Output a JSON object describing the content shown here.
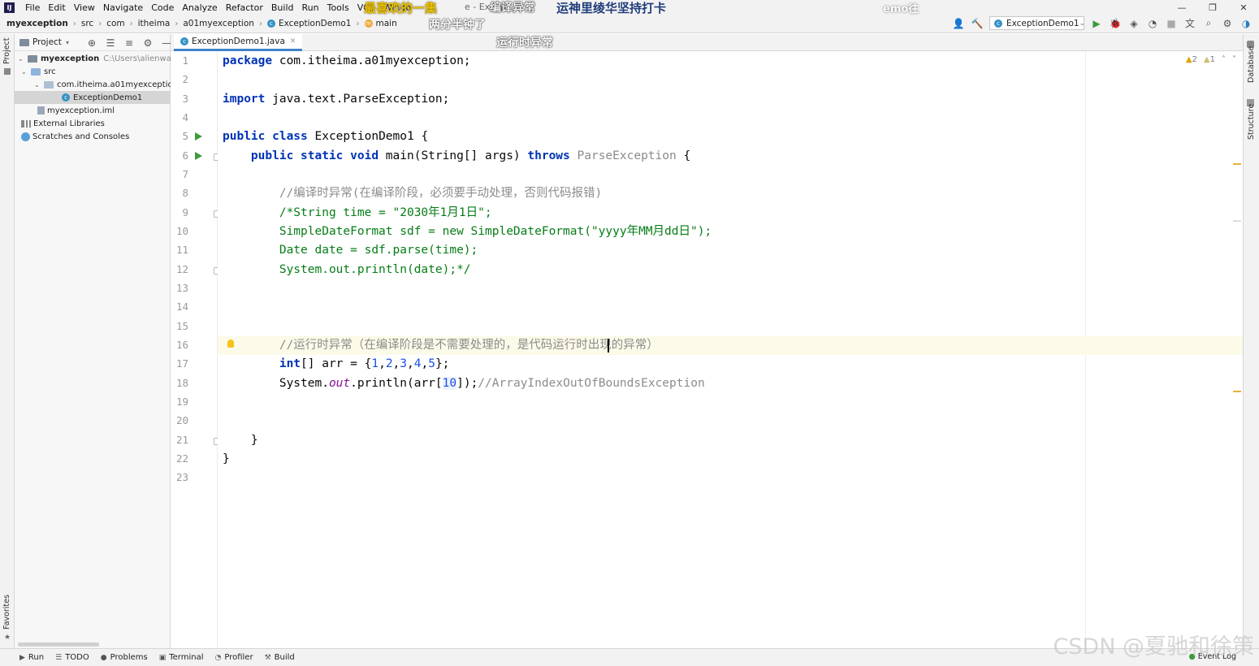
{
  "menubar": {
    "items": [
      "File",
      "Edit",
      "View",
      "Navigate",
      "Code",
      "Analyze",
      "Refactor",
      "Build",
      "Run",
      "Tools",
      "VCS",
      "Windo"
    ],
    "title": "e - Except"
  },
  "overlays": {
    "top1": "最喜欢的一集",
    "top2": "编译异常",
    "top3": "运神里绫华坚持打卡",
    "top4": "emo往",
    "mid1": "两分半钟了",
    "mid2": "运行时异常"
  },
  "breadcrumb": {
    "project": "myexception",
    "parts": [
      "src",
      "com",
      "itheima",
      "a01myexception"
    ],
    "class": "ExceptionDemo1",
    "method": "main"
  },
  "toolbar": {
    "run_config": "ExceptionDemo1"
  },
  "project_panel": {
    "header": "Project",
    "root": "myexception",
    "root_path": "C:\\Users\\alienware\\Id",
    "src": "src",
    "package": "com.itheima.a01myexception",
    "class_file": "ExceptionDemo1",
    "iml": "myexception.iml",
    "ext_libs": "External Libraries",
    "scratches": "Scratches and Consoles"
  },
  "left_strip": {
    "project_tab": "Project",
    "favorites_tab": "Favorites"
  },
  "right_strip": {
    "database_tab": "Database",
    "structure_tab": "Structure"
  },
  "editor": {
    "tab_name": "ExceptionDemo1.java",
    "warnings": "2",
    "weak_warnings": "1",
    "line_numbers": [
      "1",
      "2",
      "3",
      "4",
      "5",
      "6",
      "7",
      "8",
      "9",
      "10",
      "11",
      "12",
      "13",
      "14",
      "15",
      "16",
      "17",
      "18",
      "19",
      "20",
      "21",
      "22",
      "23"
    ],
    "code": {
      "l1_kw": "package",
      "l1_rest": " com.itheima.a01myexception;",
      "l3_kw": "import",
      "l3_rest": " java.text.ParseException;",
      "l5_kw": "public class",
      "l5_rest": " ExceptionDemo1 {",
      "l6_kw1": "    public static void",
      "l6_mid": " main(String[] args) ",
      "l6_kw2": "throws",
      "l6_gry": " ParseException",
      "l6_end": " {",
      "l8": "        //编译时异常(在编译阶段，必须要手动处理，否则代码报错)",
      "l9": "        /*String time = \"2030年1月1日\";",
      "l10": "        SimpleDateFormat sdf = new SimpleDateFormat(\"yyyy年MM月dd日\");",
      "l11": "        Date date = sdf.parse(time);",
      "l12": "        System.out.println(date);*/",
      "l16": "        //运行时异常（在编译阶段是不需要处理的，是代码运行时出现的异常）",
      "l17_kw": "        int",
      "l17_a": "[] arr = {",
      "l17_n1": "1",
      "l17_n2": "2",
      "l17_n3": "3",
      "l17_n4": "4",
      "l17_n5": "5",
      "l17_end": "};",
      "l18_a": "        System.",
      "l18_fld": "out",
      "l18_b": ".println(arr[",
      "l18_num": "10",
      "l18_c": "]);",
      "l18_cmt": "//ArrayIndexOutOfBoundsException",
      "l21": "    }",
      "l22": "}"
    }
  },
  "bottombar": {
    "run": "Run",
    "todo": "TODO",
    "problems": "Problems",
    "terminal": "Terminal",
    "profiler": "Profiler",
    "build": "Build",
    "event_log": "Event Log"
  },
  "watermark": "CSDN @夏驰和徐策"
}
